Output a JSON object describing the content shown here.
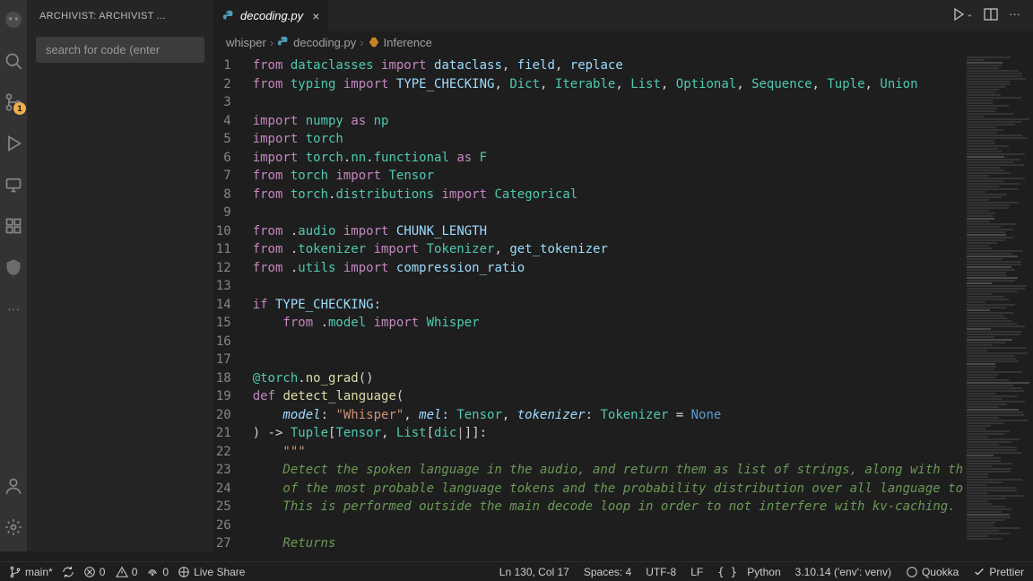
{
  "sidebar": {
    "title": "ARCHIVIST: ARCHIVIST ...",
    "search_placeholder": "search for code (enter",
    "badge": "1"
  },
  "tab": {
    "label": "decoding.py"
  },
  "breadcrumb": {
    "path1": "whisper",
    "path2": "decoding.py",
    "path3": "Inference"
  },
  "code_lines": [
    {
      "n": 1,
      "html": "<span class='kw'>from</span> <span class='mod'>dataclasses</span> <span class='kw'>import</span> <span class='id'>dataclass</span>, <span class='id'>field</span>, <span class='id'>replace</span>"
    },
    {
      "n": 2,
      "html": "<span class='kw'>from</span> <span class='mod'>typing</span> <span class='kw'>import</span> <span class='id'>TYPE_CHECKING</span>, <span class='cls'>Dict</span>, <span class='cls'>Iterable</span>, <span class='cls'>List</span>, <span class='cls'>Optional</span>, <span class='cls'>Sequence</span>, <span class='cls'>Tuple</span>, <span class='cls'>Union</span>"
    },
    {
      "n": 3,
      "html": ""
    },
    {
      "n": 4,
      "html": "<span class='kw'>import</span> <span class='mod'>numpy</span> <span class='kw'>as</span> <span class='mod'>np</span>"
    },
    {
      "n": 5,
      "html": "<span class='kw'>import</span> <span class='mod'>torch</span>"
    },
    {
      "n": 6,
      "html": "<span class='kw'>import</span> <span class='mod'>torch</span>.<span class='mod'>nn</span>.<span class='mod'>functional</span> <span class='kw'>as</span> <span class='mod'>F</span>"
    },
    {
      "n": 7,
      "html": "<span class='kw'>from</span> <span class='mod'>torch</span> <span class='kw'>import</span> <span class='cls'>Tensor</span>"
    },
    {
      "n": 8,
      "html": "<span class='kw'>from</span> <span class='mod'>torch</span>.<span class='mod'>distributions</span> <span class='kw'>import</span> <span class='cls'>Categorical</span>"
    },
    {
      "n": 9,
      "html": ""
    },
    {
      "n": 10,
      "html": "<span class='kw'>from</span> .<span class='mod'>audio</span> <span class='kw'>import</span> <span class='id'>CHUNK_LENGTH</span>"
    },
    {
      "n": 11,
      "html": "<span class='kw'>from</span> .<span class='mod'>tokenizer</span> <span class='kw'>import</span> <span class='cls'>Tokenizer</span>, <span class='id'>get_tokenizer</span>"
    },
    {
      "n": 12,
      "html": "<span class='kw'>from</span> .<span class='mod'>utils</span> <span class='kw'>import</span> <span class='id'>compression_ratio</span>"
    },
    {
      "n": 13,
      "html": ""
    },
    {
      "n": 14,
      "html": "<span class='kw'>if</span> <span class='id'>TYPE_CHECKING</span>:"
    },
    {
      "n": 15,
      "html": "    <span class='kw'>from</span> .<span class='mod'>model</span> <span class='kw'>import</span> <span class='cls'>Whisper</span>"
    },
    {
      "n": 16,
      "html": ""
    },
    {
      "n": 17,
      "html": ""
    },
    {
      "n": 18,
      "html": "<span class='deco'>@torch</span>.<span class='fn'>no_grad</span>()"
    },
    {
      "n": 19,
      "html": "<span class='kw'>def</span> <span class='fn'>detect_language</span>("
    },
    {
      "n": 20,
      "html": "    <span class='param'>model</span>: <span class='str'>\"Whisper\"</span>, <span class='param'>mel</span>: <span class='cls'>Tensor</span>, <span class='param'>tokenizer</span>: <span class='cls'>Tokenizer</span> = <span class='const'>None</span>"
    },
    {
      "n": 21,
      "html": ") -> <span class='cls'>Tuple</span>[<span class='cls'>Tensor</span>, <span class='cls'>List</span>[<span class='cls'>dic</span><span style='color:#aeafad'>&#8739;</span>]]:"
    },
    {
      "n": 22,
      "html": "    <span class='str'>\"\"\"</span>"
    },
    {
      "n": 23,
      "html": "<span class='cmt'>    Detect the spoken language in the audio, and return them as list of strings, along with th</span>"
    },
    {
      "n": 24,
      "html": "<span class='cmt'>    of the most probable language tokens and the probability distribution over all language to</span>"
    },
    {
      "n": 25,
      "html": "<span class='cmt'>    This is performed outside the main decode loop in order to not interfere with kv-caching.</span>"
    },
    {
      "n": 26,
      "html": ""
    },
    {
      "n": 27,
      "html": "<span class='cmt'>    Returns</span>"
    }
  ],
  "statusbar": {
    "branch": "main*",
    "sync": "",
    "errors": "0",
    "warnings": "0",
    "antenna": "0",
    "liveshare": "Live Share",
    "position": "Ln 130, Col 17",
    "spaces": "Spaces: 4",
    "encoding": "UTF-8",
    "eol": "LF",
    "lang": "Python",
    "interpreter": "3.10.14 ('env': venv)",
    "quokka": "Quokka",
    "prettier": "Prettier"
  }
}
